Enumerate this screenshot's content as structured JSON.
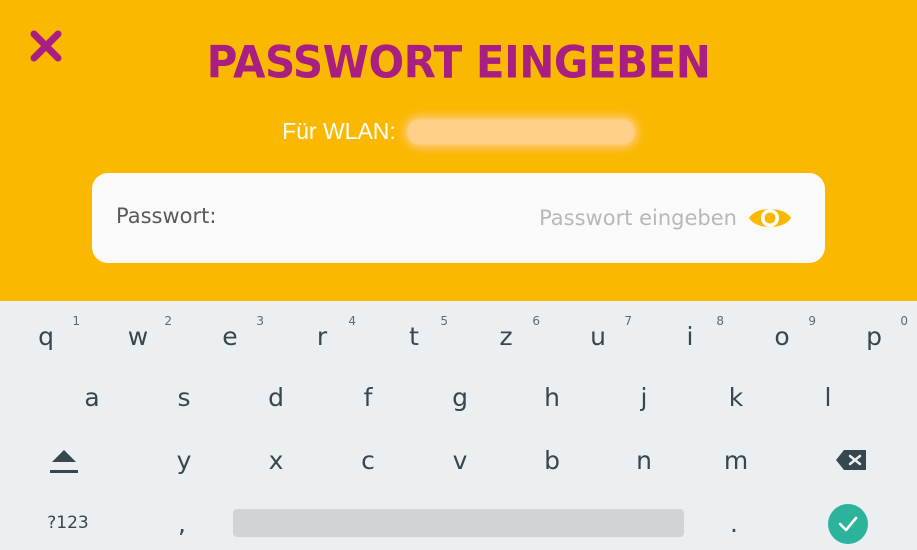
{
  "header": {
    "title": "PASSWORT EINGEBEN",
    "wlan_label": "Für WLAN:",
    "close_icon": "close-icon",
    "accent_color": "#a81e82",
    "background_color": "#fbb800"
  },
  "password": {
    "label": "Passwort:",
    "placeholder": "Passwort eingeben",
    "value": "",
    "toggle_icon": "eye-icon"
  },
  "keyboard": {
    "row1": [
      {
        "key": "q",
        "hint": "1"
      },
      {
        "key": "w",
        "hint": "2"
      },
      {
        "key": "e",
        "hint": "3"
      },
      {
        "key": "r",
        "hint": "4"
      },
      {
        "key": "t",
        "hint": "5"
      },
      {
        "key": "z",
        "hint": "6"
      },
      {
        "key": "u",
        "hint": "7"
      },
      {
        "key": "i",
        "hint": "8"
      },
      {
        "key": "o",
        "hint": "9"
      },
      {
        "key": "p",
        "hint": "0"
      }
    ],
    "row2": [
      "a",
      "s",
      "d",
      "f",
      "g",
      "h",
      "j",
      "k",
      "l"
    ],
    "row3": [
      "y",
      "x",
      "c",
      "v",
      "b",
      "n",
      "m"
    ],
    "symbols_label": "?123",
    "comma": ",",
    "period": ".",
    "shift_icon": "shift-icon",
    "backspace_icon": "backspace-icon",
    "enter_icon": "checkmark-icon",
    "enter_color": "#2bb39c"
  }
}
